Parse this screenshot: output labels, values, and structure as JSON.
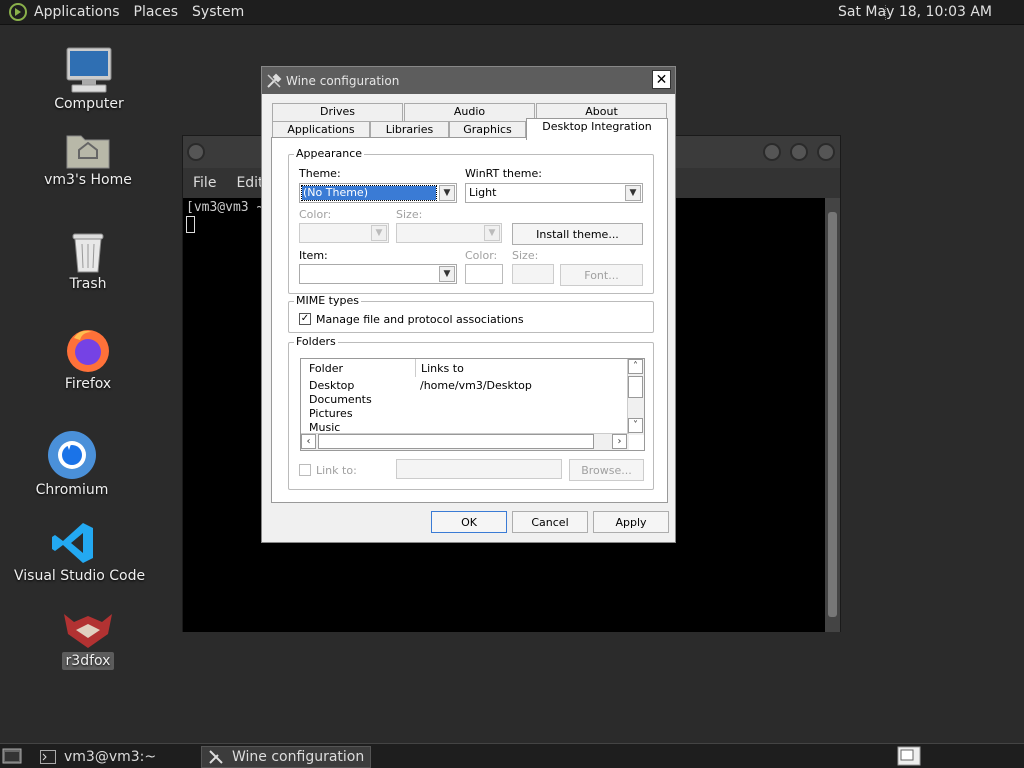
{
  "top_panel": {
    "menus": [
      "Applications",
      "Places",
      "System"
    ],
    "clock": "Sat May 18, 10:03 AM"
  },
  "desktop": {
    "icons": [
      "Computer",
      "vm3's Home",
      "Trash",
      "Firefox",
      "Chromium",
      "Visual Studio Code",
      "r3dfox"
    ]
  },
  "terminal": {
    "menus": [
      "File",
      "Edit"
    ],
    "prompt": "[vm3@vm3 ~"
  },
  "dialog": {
    "title": "Wine configuration",
    "close_glyph": "✕",
    "tabs_row1": [
      "Drives",
      "Audio",
      "About"
    ],
    "tabs_row2": [
      "Applications",
      "Libraries",
      "Graphics",
      "Desktop Integration"
    ],
    "appearance": {
      "group_label": "Appearance",
      "theme_label": "Theme:",
      "theme_value": "(No Theme)",
      "winrt_label": "WinRT theme:",
      "winrt_value": "Light",
      "color_label": "Color:",
      "size_label": "Size:",
      "install_button": "Install theme...",
      "item_label": "Item:",
      "item_color_label": "Color:",
      "item_size_label": "Size:",
      "font_button": "Font..."
    },
    "mime": {
      "group_label": "MIME types",
      "checkbox_label": "Manage file and protocol associations",
      "checked_glyph": "✓"
    },
    "folders": {
      "group_label": "Folders",
      "col_folder": "Folder",
      "col_links": "Links to",
      "rows": [
        {
          "folder": "Desktop",
          "link": "/home/vm3/Desktop"
        },
        {
          "folder": "Documents",
          "link": ""
        },
        {
          "folder": "Pictures",
          "link": ""
        },
        {
          "folder": "Music",
          "link": ""
        }
      ],
      "link_to_label": "Link to:",
      "browse_button": "Browse..."
    },
    "buttons": {
      "ok": "OK",
      "cancel": "Cancel",
      "apply": "Apply"
    }
  },
  "taskbar": {
    "items": [
      "vm3@vm3:~",
      "Wine configuration"
    ]
  }
}
